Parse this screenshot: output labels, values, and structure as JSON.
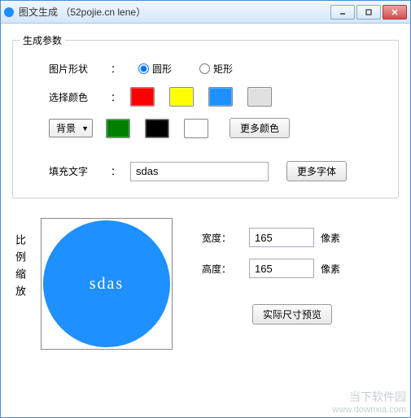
{
  "window": {
    "title": "图文生成 （52pojie.cn lene）"
  },
  "group": {
    "title": "生成参数",
    "shape": {
      "label": "图片形状",
      "colon": "：",
      "option_circle": "圆形",
      "option_rect": "矩形"
    },
    "color": {
      "label": "选择颜色",
      "colon": "："
    },
    "bg": {
      "selected": "背景",
      "more_colors": "更多颜色"
    },
    "text": {
      "label": "填充文字",
      "colon": "：",
      "value": "sdas",
      "more_fonts": "更多字体"
    }
  },
  "preview": {
    "scale_label": "比例缩放",
    "text": "sdas"
  },
  "dims": {
    "width_label": "宽度：",
    "width_value": "165",
    "height_label": "高度：",
    "height_value": "165",
    "unit": "像素",
    "actual_size": "实际尺寸预览"
  },
  "watermark": {
    "line1": "当下软件园",
    "line2": "www.downxia.com"
  }
}
